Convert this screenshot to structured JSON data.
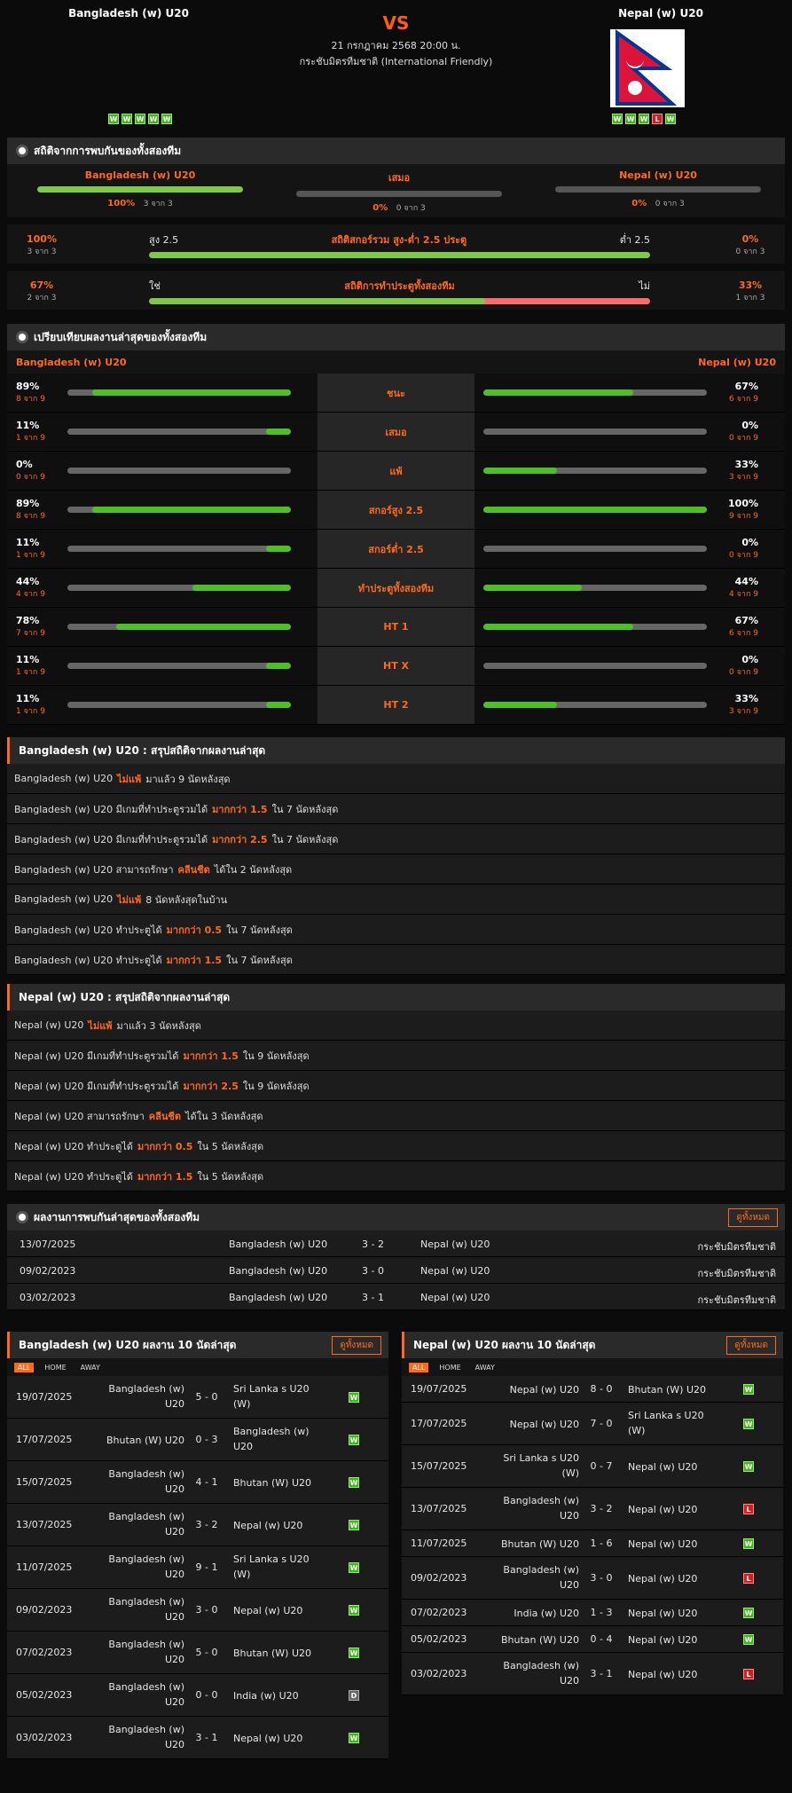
{
  "header": {
    "home_team": "Bangladesh (w) U20",
    "away_team": "Nepal (w) U20",
    "vs": "VS",
    "date": "21 กรกฎาคม 2568 20:00 น.",
    "competition": "กระชับมิตรทีมชาติ (International Friendly)",
    "home_form": [
      "W",
      "W",
      "W",
      "W",
      "W"
    ],
    "away_form": [
      "W",
      "W",
      "W",
      "L",
      "W"
    ]
  },
  "h2h_stats": {
    "title": "สถิติจากการพบกันของทั้งสองทีม",
    "home": {
      "label": "Bangladesh (w) U20",
      "pct": "100%",
      "count": "3 จาก 3",
      "fill": 1.0
    },
    "draw": {
      "label": "เสมอ",
      "pct": "0%",
      "count": "0 จาก 3",
      "fill": 0
    },
    "away": {
      "label": "Nepal (w) U20",
      "pct": "0%",
      "count": "0 จาก 3",
      "fill": 0
    },
    "ou": {
      "left_pct": "100%",
      "left_count": "3 จาก 3",
      "left_label": "สูง 2.5",
      "center": "สถิติสกอร์รวม สูง-ต่ำ 2.5 ประตู",
      "right_label": "ต่ำ 2.5",
      "right_pct": "0%",
      "right_count": "0 จาก 3",
      "fill": 1.0
    },
    "btts": {
      "left_pct": "67%",
      "left_count": "2 จาก 3",
      "left_label": "ใช่",
      "center": "สถิติการทำประตูทั้งสองทีม",
      "right_label": "ไม่",
      "right_pct": "33%",
      "right_count": "1 จาก 3",
      "fill": 0.67
    }
  },
  "compare": {
    "title": "เปรียบเทียบผลงานล่าสุดของทั้งสองทีม",
    "home_team": "Bangladesh (w) U20",
    "away_team": "Nepal (w) U20",
    "rows": [
      {
        "label": "ชนะ",
        "hp": "89%",
        "hc": "8 จาก 9",
        "hf": 0.89,
        "ap": "67%",
        "ac": "6 จาก 9",
        "af": 0.67
      },
      {
        "label": "เสมอ",
        "hp": "11%",
        "hc": "1 จาก 9",
        "hf": 0.11,
        "ap": "0%",
        "ac": "0 จาก 9",
        "af": 0
      },
      {
        "label": "แพ้",
        "hp": "0%",
        "hc": "0 จาก 9",
        "hf": 0,
        "ap": "33%",
        "ac": "3 จาก 9",
        "af": 0.33
      },
      {
        "label": "สกอร์สูง 2.5",
        "hp": "89%",
        "hc": "8 จาก 9",
        "hf": 0.89,
        "ap": "100%",
        "ac": "9 จาก 9",
        "af": 1.0
      },
      {
        "label": "สกอร์ต่ำ 2.5",
        "hp": "11%",
        "hc": "1 จาก 9",
        "hf": 0.11,
        "ap": "0%",
        "ac": "0 จาก 9",
        "af": 0
      },
      {
        "label": "ทำประตูทั้งสองทีม",
        "hp": "44%",
        "hc": "4 จาก 9",
        "hf": 0.44,
        "ap": "44%",
        "ac": "4 จาก 9",
        "af": 0.44
      },
      {
        "label": "HT 1",
        "hp": "78%",
        "hc": "7 จาก 9",
        "hf": 0.78,
        "ap": "67%",
        "ac": "6 จาก 9",
        "af": 0.67
      },
      {
        "label": "HT X",
        "hp": "11%",
        "hc": "1 จาก 9",
        "hf": 0.11,
        "ap": "0%",
        "ac": "0 จาก 9",
        "af": 0
      },
      {
        "label": "HT 2",
        "hp": "11%",
        "hc": "1 จาก 9",
        "hf": 0.11,
        "ap": "33%",
        "ac": "3 จาก 9",
        "af": 0.33
      }
    ]
  },
  "home_summary": {
    "title": "Bangladesh (w) U20 : สรุปสถิติจากผลงานล่าสุด",
    "rows": [
      {
        "pre": "Bangladesh (w) U20",
        "hl": "ไม่แพ้",
        "post": "มาแล้ว 9 นัดหลังสุด"
      },
      {
        "pre": "Bangladesh (w) U20 มีเกมที่ทำประตูรวมได้",
        "hl": "มากกว่า 1.5",
        "post": "ใน 7 นัดหลังสุด"
      },
      {
        "pre": "Bangladesh (w) U20 มีเกมที่ทำประตูรวมได้",
        "hl": "มากกว่า 2.5",
        "post": "ใน 7 นัดหลังสุด"
      },
      {
        "pre": "Bangladesh (w) U20 สามารถรักษา",
        "hl": "คลีนชีต",
        "post": "ได้ใน 2 นัดหลังสุด"
      },
      {
        "pre": "Bangladesh (w) U20",
        "hl": "ไม่แพ้",
        "post": "8 นัดหลังสุดในบ้าน"
      },
      {
        "pre": "Bangladesh (w) U20 ทำประตูได้",
        "hl": "มากกว่า 0.5",
        "post": "ใน 7 นัดหลังสุด"
      },
      {
        "pre": "Bangladesh (w) U20 ทำประตูได้",
        "hl": "มากกว่า 1.5",
        "post": "ใน 7 นัดหลังสุด"
      }
    ]
  },
  "away_summary": {
    "title": "Nepal (w) U20 : สรุปสถิติจากผลงานล่าสุด",
    "rows": [
      {
        "pre": "Nepal (w) U20",
        "hl": "ไม่แพ้",
        "post": "มาแล้ว 3 นัดหลังสุด"
      },
      {
        "pre": "Nepal (w) U20 มีเกมที่ทำประตูรวมได้",
        "hl": "มากกว่า 1.5",
        "post": "ใน 9 นัดหลังสุด"
      },
      {
        "pre": "Nepal (w) U20 มีเกมที่ทำประตูรวมได้",
        "hl": "มากกว่า 2.5",
        "post": "ใน 9 นัดหลังสุด"
      },
      {
        "pre": "Nepal (w) U20 สามารถรักษา",
        "hl": "คลีนชีต",
        "post": "ได้ใน 3 นัดหลังสุด"
      },
      {
        "pre": "Nepal (w) U20 ทำประตูได้",
        "hl": "มากกว่า 0.5",
        "post": "ใน 5 นัดหลังสุด"
      },
      {
        "pre": "Nepal (w) U20 ทำประตูได้",
        "hl": "มากกว่า 1.5",
        "post": "ใน 5 นัดหลังสุด"
      }
    ]
  },
  "h2h_matches": {
    "title": "ผลงานการพบกันล่าสุดของทั้งสองทีม",
    "see_all": "ดูทั้งหมด",
    "rows": [
      {
        "date": "13/07/2025",
        "home": "Bangladesh (w) U20",
        "score": "3 - 2",
        "away": "Nepal (w) U20",
        "comp": "กระชับมิตรทีมชาติ"
      },
      {
        "date": "09/02/2023",
        "home": "Bangladesh (w) U20",
        "score": "3 - 0",
        "away": "Nepal (w) U20",
        "comp": "กระชับมิตรทีมชาติ"
      },
      {
        "date": "03/02/2023",
        "home": "Bangladesh (w) U20",
        "score": "3 - 1",
        "away": "Nepal (w) U20",
        "comp": "กระชับมิตรทีมชาติ"
      }
    ]
  },
  "home_last10": {
    "title": "Bangladesh (w) U20 ผลงาน 10 นัดล่าสุด",
    "see_all": "ดูทั้งหมด",
    "tabs": [
      "ALL",
      "HOME",
      "AWAY"
    ],
    "rows": [
      {
        "date": "19/07/2025",
        "home": "Bangladesh (w) U20",
        "score": "5 - 0",
        "away": "Sri Lanka s U20 (W)",
        "res": "W"
      },
      {
        "date": "17/07/2025",
        "home": "Bhutan (W) U20",
        "score": "0 - 3",
        "away": "Bangladesh (w) U20",
        "res": "W"
      },
      {
        "date": "15/07/2025",
        "home": "Bangladesh (w) U20",
        "score": "4 - 1",
        "away": "Bhutan (W) U20",
        "res": "W"
      },
      {
        "date": "13/07/2025",
        "home": "Bangladesh (w) U20",
        "score": "3 - 2",
        "away": "Nepal (w) U20",
        "res": "W"
      },
      {
        "date": "11/07/2025",
        "home": "Bangladesh (w) U20",
        "score": "9 - 1",
        "away": "Sri Lanka s U20 (W)",
        "res": "W"
      },
      {
        "date": "09/02/2023",
        "home": "Bangladesh (w) U20",
        "score": "3 - 0",
        "away": "Nepal (w) U20",
        "res": "W"
      },
      {
        "date": "07/02/2023",
        "home": "Bangladesh (w) U20",
        "score": "5 - 0",
        "away": "Bhutan (W) U20",
        "res": "W"
      },
      {
        "date": "05/02/2023",
        "home": "Bangladesh (w) U20",
        "score": "0 - 0",
        "away": "India (w) U20",
        "res": "D"
      },
      {
        "date": "03/02/2023",
        "home": "Bangladesh (w) U20",
        "score": "3 - 1",
        "away": "Nepal (w) U20",
        "res": "W"
      }
    ]
  },
  "away_last10": {
    "title": "Nepal (w) U20 ผลงาน 10 นัดล่าสุด",
    "see_all": "ดูทั้งหมด",
    "tabs": [
      "ALL",
      "HOME",
      "AWAY"
    ],
    "rows": [
      {
        "date": "19/07/2025",
        "home": "Nepal (w) U20",
        "score": "8 - 0",
        "away": "Bhutan (W) U20",
        "res": "W"
      },
      {
        "date": "17/07/2025",
        "home": "Nepal (w) U20",
        "score": "7 - 0",
        "away": "Sri Lanka s U20 (W)",
        "res": "W"
      },
      {
        "date": "15/07/2025",
        "home": "Sri Lanka s U20 (W)",
        "score": "0 - 7",
        "away": "Nepal (w) U20",
        "res": "W"
      },
      {
        "date": "13/07/2025",
        "home": "Bangladesh (w) U20",
        "score": "3 - 2",
        "away": "Nepal (w) U20",
        "res": "L"
      },
      {
        "date": "11/07/2025",
        "home": "Bhutan (W) U20",
        "score": "1 - 6",
        "away": "Nepal (w) U20",
        "res": "W"
      },
      {
        "date": "09/02/2023",
        "home": "Bangladesh (w) U20",
        "score": "3 - 0",
        "away": "Nepal (w) U20",
        "res": "L"
      },
      {
        "date": "07/02/2023",
        "home": "India (w) U20",
        "score": "1 - 3",
        "away": "Nepal (w) U20",
        "res": "W"
      },
      {
        "date": "05/02/2023",
        "home": "Bhutan (W) U20",
        "score": "0 - 4",
        "away": "Nepal (w) U20",
        "res": "W"
      },
      {
        "date": "03/02/2023",
        "home": "Bangladesh (w) U20",
        "score": "3 - 1",
        "away": "Nepal (w) U20",
        "res": "L"
      }
    ]
  },
  "colors": {
    "accent": "#ff6a1a",
    "win": "#3fb618",
    "loss": "#d21f1f",
    "draw": "#666666",
    "bar_green": "#7fc94a",
    "bar_red": "#ff6b6b"
  }
}
